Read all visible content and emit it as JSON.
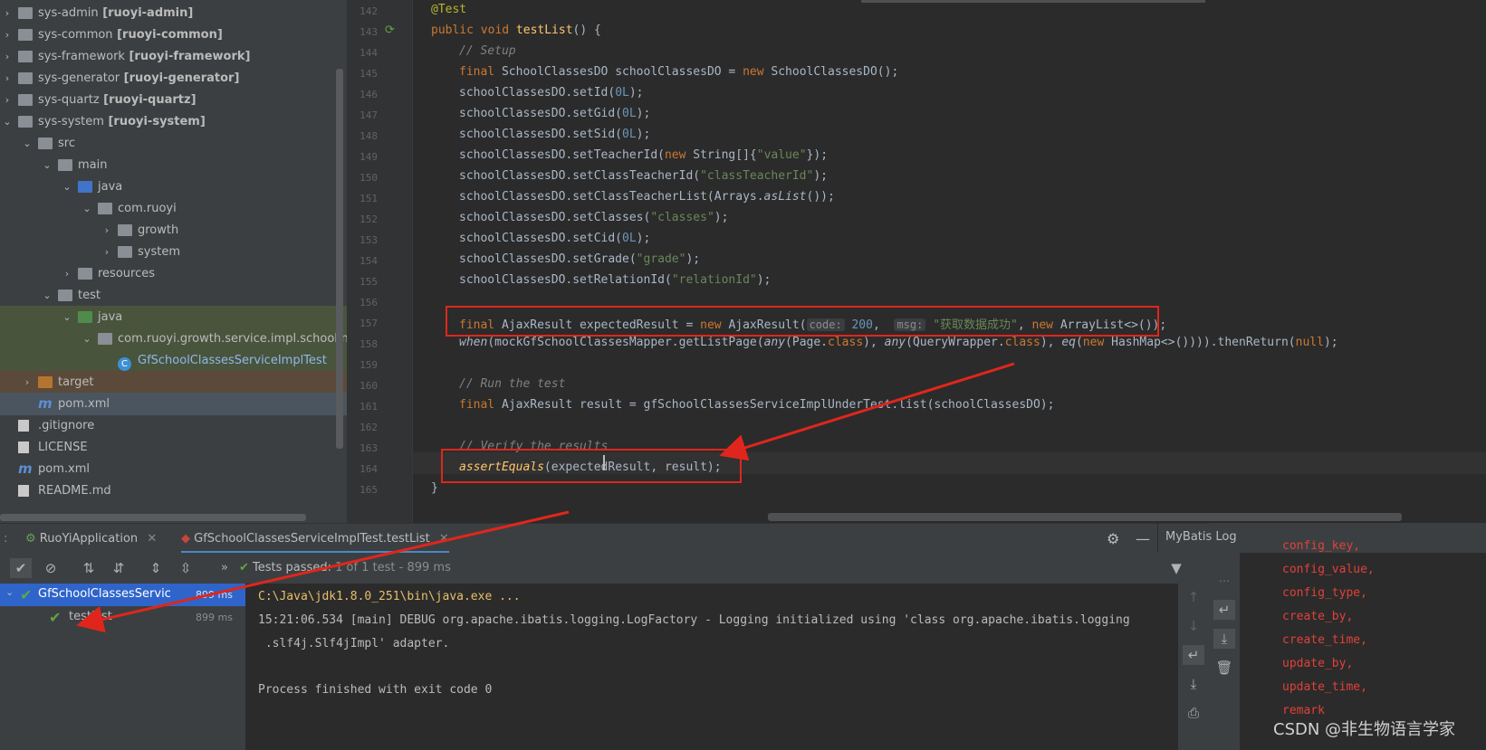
{
  "tree": {
    "items": [
      {
        "chev": "›",
        "icon": "folder",
        "label": "sys-admin",
        "bold": "[ruoyi-admin]"
      },
      {
        "chev": "›",
        "icon": "folder",
        "label": "sys-common",
        "bold": "[ruoyi-common]"
      },
      {
        "chev": "›",
        "icon": "folder",
        "label": "sys-framework",
        "bold": "[ruoyi-framework]"
      },
      {
        "chev": "›",
        "icon": "folder",
        "label": "sys-generator",
        "bold": "[ruoyi-generator]"
      },
      {
        "chev": "›",
        "icon": "folder",
        "label": "sys-quartz",
        "bold": "[ruoyi-quartz]"
      },
      {
        "chev": "⌄",
        "icon": "folder",
        "label": "sys-system",
        "bold": "[ruoyi-system]"
      },
      {
        "chev": "⌄",
        "icon": "folder",
        "label": "src",
        "bold": ""
      },
      {
        "chev": "⌄",
        "icon": "folder",
        "label": "main",
        "bold": ""
      },
      {
        "chev": "⌄",
        "icon": "folder-blue",
        "label": "java",
        "bold": ""
      },
      {
        "chev": "⌄",
        "icon": "package",
        "label": "com.ruoyi",
        "bold": ""
      },
      {
        "chev": "›",
        "icon": "package",
        "label": "growth",
        "bold": ""
      },
      {
        "chev": "›",
        "icon": "package",
        "label": "system",
        "bold": ""
      },
      {
        "chev": "›",
        "icon": "folder",
        "label": "resources",
        "bold": ""
      },
      {
        "chev": "⌄",
        "icon": "folder",
        "label": "test",
        "bold": ""
      },
      {
        "chev": "⌄",
        "icon": "folder-green",
        "label": "java",
        "bold": ""
      },
      {
        "chev": "⌄",
        "icon": "package",
        "label": "com.ruoyi.growth.service.impl.schoolImp",
        "bold": ""
      },
      {
        "chev": "",
        "icon": "class",
        "label": "GfSchoolClassesServiceImplTest",
        "bold": ""
      },
      {
        "chev": "›",
        "icon": "folder-orange",
        "label": "target",
        "bold": ""
      },
      {
        "chev": "",
        "icon": "maven",
        "label": "pom.xml",
        "bold": ""
      },
      {
        "chev": "",
        "icon": "file",
        "label": ".gitignore",
        "bold": ""
      },
      {
        "chev": "",
        "icon": "file",
        "label": "LICENSE",
        "bold": ""
      },
      {
        "chev": "",
        "icon": "maven",
        "label": "pom.xml",
        "bold": ""
      },
      {
        "chev": "",
        "icon": "md",
        "label": "README.md",
        "bold": ""
      }
    ]
  },
  "editor": {
    "lines": [
      {
        "n": "142",
        "html": "<span class='ann'>@Test</span>",
        "indent": 0
      },
      {
        "n": "143",
        "html": "<span class='kw'>public void </span><span class='fn'>testList</span>() {",
        "indent": 0
      },
      {
        "n": "144",
        "html": "<span class='cmt'>// Setup</span>",
        "indent": 1
      },
      {
        "n": "145",
        "html": "<span class='kw'>final </span>SchoolClassesDO schoolClassesDO = <span class='kw'>new </span>SchoolClassesDO();",
        "indent": 1
      },
      {
        "n": "146",
        "html": "schoolClassesDO.setId(<span class='num'>0L</span>);",
        "indent": 1
      },
      {
        "n": "147",
        "html": "schoolClassesDO.setGid(<span class='num'>0L</span>);",
        "indent": 1
      },
      {
        "n": "148",
        "html": "schoolClassesDO.setSid(<span class='num'>0L</span>);",
        "indent": 1
      },
      {
        "n": "149",
        "html": "schoolClassesDO.setTeacherId(<span class='kw'>new </span>String[]{<span class='str'>\"value\"</span>});",
        "indent": 1
      },
      {
        "n": "150",
        "html": "schoolClassesDO.setClassTeacherId(<span class='str'>\"classTeacherId\"</span>);",
        "indent": 1
      },
      {
        "n": "151",
        "html": "schoolClassesDO.setClassTeacherList(Arrays.<i>asList</i>());",
        "indent": 1
      },
      {
        "n": "152",
        "html": "schoolClassesDO.setClasses(<span class='str'>\"classes\"</span>);",
        "indent": 1
      },
      {
        "n": "153",
        "html": "schoolClassesDO.setCid(<span class='num'>0L</span>);",
        "indent": 1
      },
      {
        "n": "154",
        "html": "schoolClassesDO.setGrade(<span class='str'>\"grade\"</span>);",
        "indent": 1
      },
      {
        "n": "155",
        "html": "schoolClassesDO.setRelationId(<span class='str'>\"relationId\"</span>);",
        "indent": 1
      },
      {
        "n": "156",
        "html": "",
        "indent": 1
      },
      {
        "n": "157",
        "html": "<span class='kw'>final </span>AjaxResult expectedResult = <span class='kw'>new </span>AjaxResult(<span class='hint'>code:</span> <span class='num'>200</span>,  <span class='hint'>msg:</span> <span class='str'>\"获取数据成功\"</span>, <span class='kw'>new </span>ArrayList&lt;&gt;());",
        "indent": 1
      },
      {
        "n": "158",
        "html": "<i>when</i>(mockGfSchoolClassesMapper.getListPage(<i>any</i>(Page.<span class='kw'>class</span>), <i>any</i>(QueryWrapper.<span class='kw'>class</span>), <i>eq</i>(<span class='kw'>new </span>HashMap&lt;&gt;()))).thenReturn(<span class='kw'>null</span>);",
        "indent": 1
      },
      {
        "n": "159",
        "html": "",
        "indent": 1
      },
      {
        "n": "160",
        "html": "<span class='cmt'>// Run the test</span>",
        "indent": 1
      },
      {
        "n": "161",
        "html": "<span class='kw'>final </span>AjaxResult result = gfSchoolClassesServiceImplUnderTest.list(schoolClassesDO);",
        "indent": 1
      },
      {
        "n": "162",
        "html": "",
        "indent": 1
      },
      {
        "n": "163",
        "html": "<span class='cmt'>// Verify the results</span>",
        "indent": 1
      },
      {
        "n": "164",
        "html": "<i class='fn'>assertEquals</i>(expectedResult, result);",
        "indent": 1
      },
      {
        "n": "165",
        "html": "}",
        "indent": 0
      }
    ]
  },
  "runbar": {
    "tab1": "RuoYiApplication",
    "tab2": "GfSchoolClassesServiceImplTest.testList",
    "mybatis_title": "MyBatis Log"
  },
  "status": {
    "passed_label": "Tests passed:",
    "passed_detail": "1 of 1 test - 899 ms"
  },
  "testtree": {
    "root": "GfSchoolClassesServic",
    "root_time": "899 ms",
    "child": "testList",
    "child_time": "899 ms"
  },
  "console": {
    "line1": "C:\\Java\\jdk1.8.0_251\\bin\\java.exe ...",
    "line2": "15:21:06.534 [main] DEBUG org.apache.ibatis.logging.LogFactory - Logging initialized using 'class org.apache.ibatis.logging",
    "line3": " .slf4j.Slf4jImpl' adapter.",
    "line4": "Process finished with exit code 0"
  },
  "mybatis": {
    "lines": [
      "config_key,",
      "config_value,",
      "config_type,",
      "create_by,",
      "create_time,",
      "update_by,",
      "update_time,",
      "remark"
    ]
  },
  "watermark": "CSDN @非生物语言学家"
}
